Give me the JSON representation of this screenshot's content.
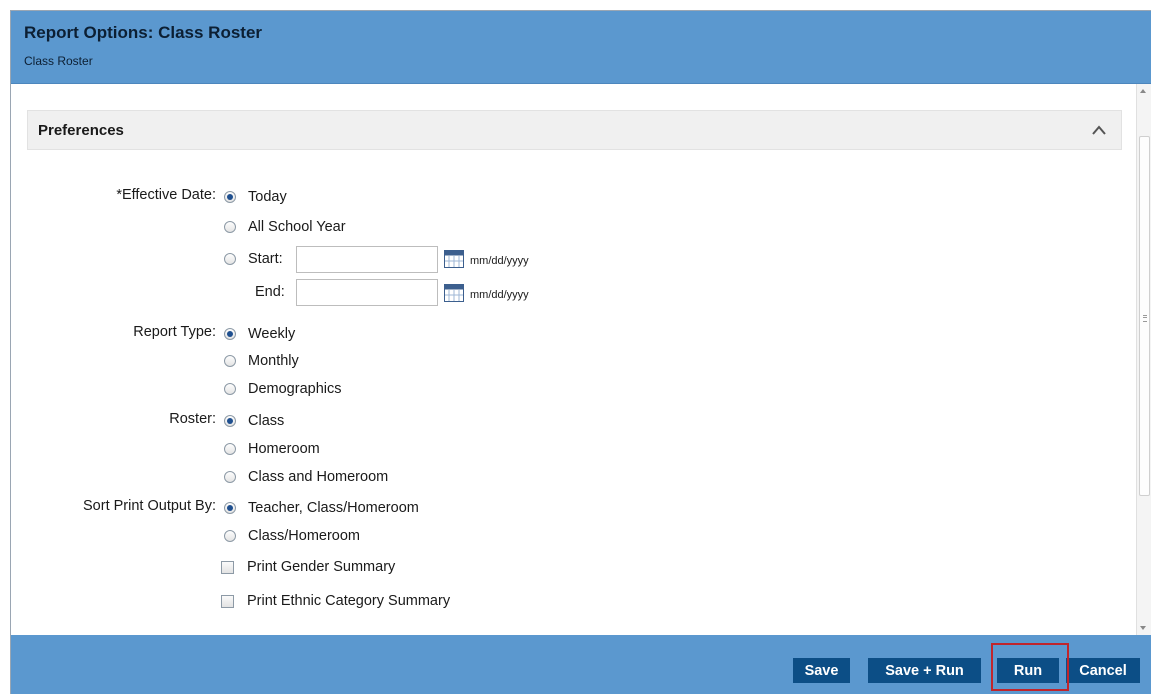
{
  "header": {
    "title": "Report Options: Class Roster",
    "subtitle": "Class Roster"
  },
  "section": {
    "title": "Preferences",
    "collapse_icon": "chevron-up-icon"
  },
  "effective_date": {
    "label": "*Effective Date:",
    "options": [
      "Today",
      "All School Year",
      "Start:"
    ],
    "selected": "Today",
    "start_value": "",
    "end_label": "End:",
    "end_value": "",
    "date_format": "mm/dd/yyyy"
  },
  "report_type": {
    "label": "Report Type:",
    "options": [
      "Weekly",
      "Monthly",
      "Demographics"
    ],
    "selected": "Weekly"
  },
  "roster": {
    "label": "Roster:",
    "options": [
      "Class",
      "Homeroom",
      "Class and Homeroom"
    ],
    "selected": "Class"
  },
  "sort": {
    "label": "Sort Print Output By:",
    "options": [
      "Teacher, Class/Homeroom",
      "Class/Homeroom"
    ],
    "selected": "Teacher, Class/Homeroom"
  },
  "checkboxes": [
    {
      "label": "Print Gender Summary",
      "checked": false
    },
    {
      "label": "Print Ethnic Category Summary",
      "checked": false
    }
  ],
  "footer": {
    "save": "Save",
    "save_run": "Save + Run",
    "run": "Run",
    "cancel": "Cancel"
  },
  "colors": {
    "header_bg": "#5b98cf",
    "button_bg": "#0c4e86",
    "highlight": "#c0252c"
  }
}
